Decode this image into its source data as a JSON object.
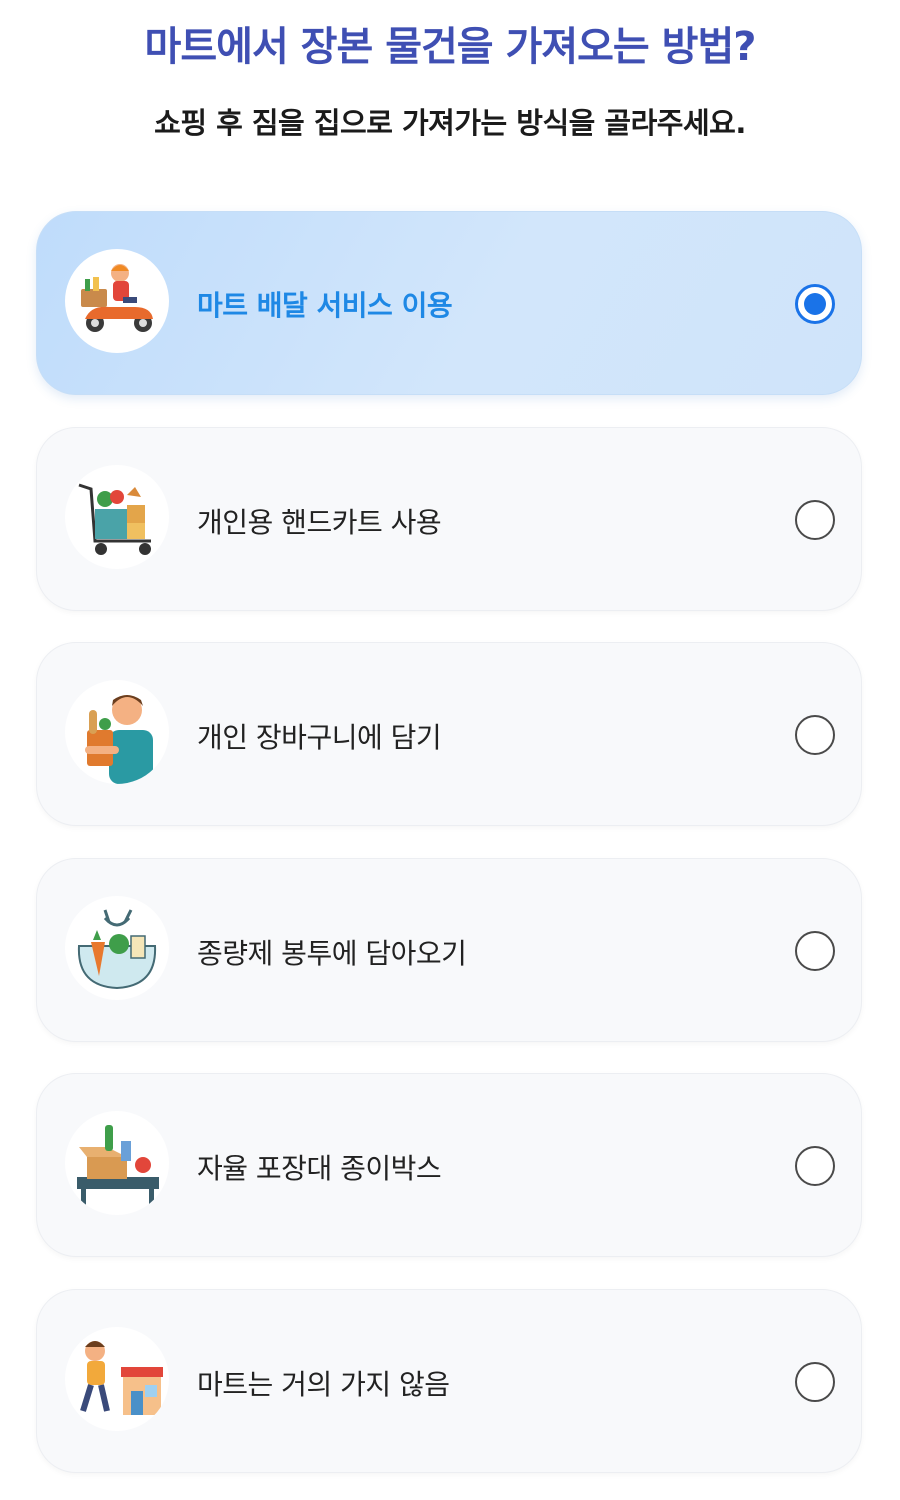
{
  "header": {
    "title": "마트에서 장본 물건을 가져오는 방법?",
    "subtitle": "쇼핑 후 짐을 집으로 가져가는 방식을 골라주세요."
  },
  "options": [
    {
      "label": "마트 배달 서비스 이용",
      "icon": "delivery-scooter-icon",
      "selected": true
    },
    {
      "label": "개인용 핸드카트 사용",
      "icon": "hand-cart-icon",
      "selected": false
    },
    {
      "label": "개인 장바구니에 담기",
      "icon": "shopping-bag-person-icon",
      "selected": false
    },
    {
      "label": "종량제 봉투에 담아오기",
      "icon": "grocery-bag-icon",
      "selected": false
    },
    {
      "label": "자율 포장대 종이박스",
      "icon": "cardboard-box-icon",
      "selected": false
    },
    {
      "label": "마트는 거의 가지 않음",
      "icon": "walking-store-icon",
      "selected": false
    }
  ],
  "colors": {
    "title": "#3f4fb3",
    "accent": "#1a73e8",
    "selected_label": "#1e88e5",
    "selected_bg": "#cfe4fa"
  }
}
